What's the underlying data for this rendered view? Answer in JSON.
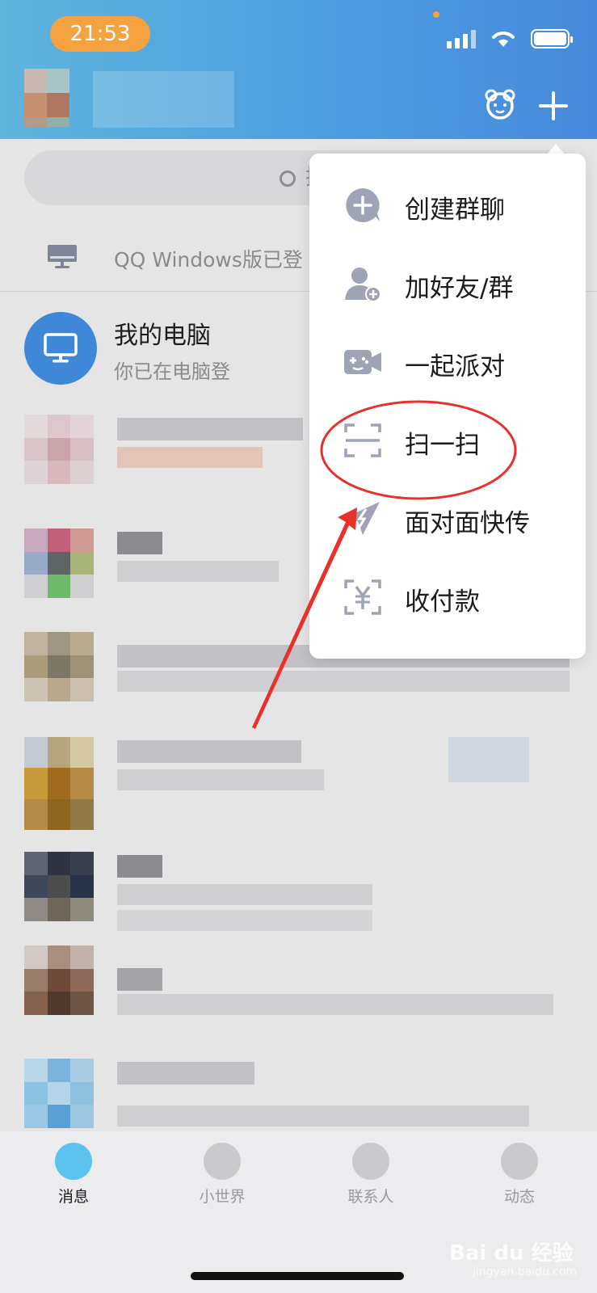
{
  "status_bar": {
    "time": "21:53"
  },
  "search": {
    "placeholder": "搜"
  },
  "pc_notice": {
    "text": "QQ Windows版已登"
  },
  "my_computer": {
    "title": "我的电脑",
    "subtitle": "你已在电脑登"
  },
  "menu": {
    "items": [
      {
        "label": "创建群聊",
        "icon": "create-group-icon"
      },
      {
        "label": "加好友/群",
        "icon": "add-friend-icon"
      },
      {
        "label": "一起派对",
        "icon": "party-game-icon"
      },
      {
        "label": "扫一扫",
        "icon": "scan-icon",
        "highlighted": true
      },
      {
        "label": "面对面快传",
        "icon": "quick-send-icon"
      },
      {
        "label": "收付款",
        "icon": "payment-icon"
      }
    ]
  },
  "bottom_nav": {
    "tabs": [
      {
        "label": "消息",
        "active": true
      },
      {
        "label": "小世界"
      },
      {
        "label": "联系人"
      },
      {
        "label": "动态"
      }
    ]
  },
  "watermark": {
    "brand": "Bai du 经验",
    "url": "jingyan.baidu.com"
  },
  "colors": {
    "header_start": "#5fb4dc",
    "header_end": "#4789dc",
    "time_pill": "#f5a241",
    "annotation_red": "#e8312b",
    "menu_icon": "#9ea3b6"
  }
}
